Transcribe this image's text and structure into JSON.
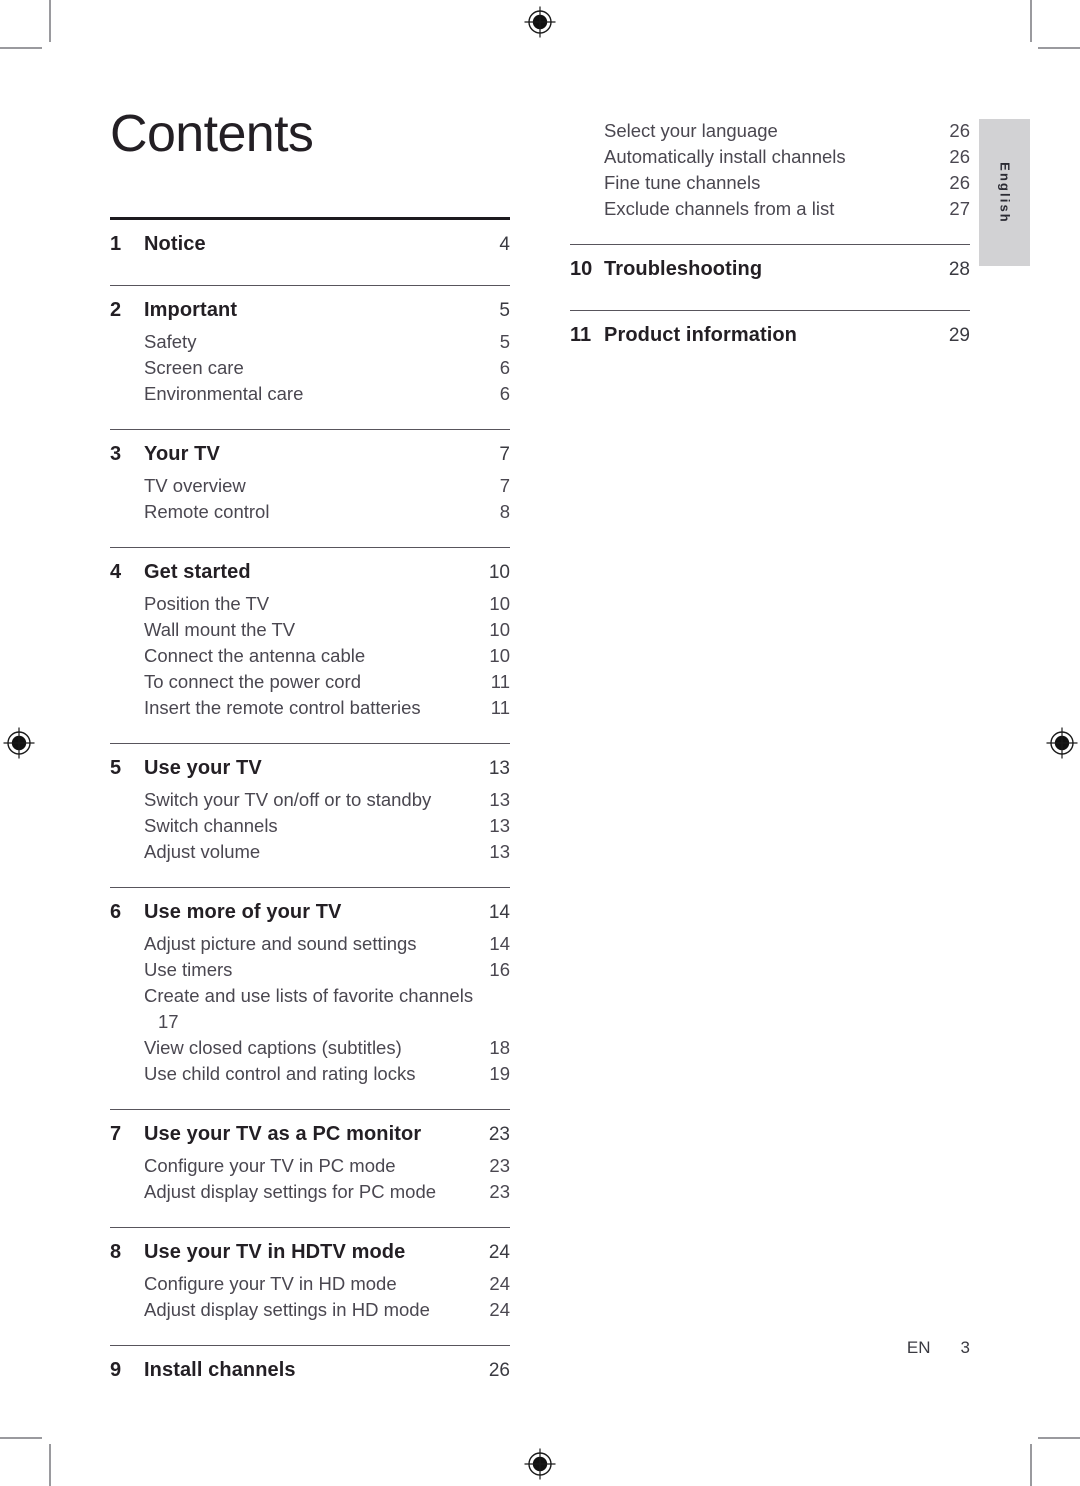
{
  "document": {
    "title": "Contents",
    "language_tab": "English",
    "footer": {
      "language_code": "EN",
      "page_number": "3"
    }
  },
  "left_column": {
    "groups": [
      {
        "rule": "thick",
        "entries": [
          {
            "type": "chapter",
            "num": "1",
            "label": "Notice",
            "page": "4"
          }
        ]
      },
      {
        "rule": "thin",
        "entries": [
          {
            "type": "chapter",
            "num": "2",
            "label": "Important",
            "page": "5"
          },
          {
            "type": "sub",
            "label": "Safety",
            "page": "5"
          },
          {
            "type": "sub",
            "label": "Screen care",
            "page": "6"
          },
          {
            "type": "sub",
            "label": "Environmental care",
            "page": "6"
          }
        ]
      },
      {
        "rule": "thin",
        "entries": [
          {
            "type": "chapter",
            "num": "3",
            "label": "Your TV",
            "page": "7"
          },
          {
            "type": "sub",
            "label": "TV overview",
            "page": "7"
          },
          {
            "type": "sub",
            "label": "Remote control",
            "page": "8"
          }
        ]
      },
      {
        "rule": "thin",
        "entries": [
          {
            "type": "chapter",
            "num": "4",
            "label": "Get started",
            "page": "10"
          },
          {
            "type": "sub",
            "label": "Position the TV",
            "page": "10"
          },
          {
            "type": "sub",
            "label": "Wall mount the TV",
            "page": "10"
          },
          {
            "type": "sub",
            "label": "Connect the antenna cable",
            "page": "10"
          },
          {
            "type": "sub",
            "label": "To connect the power cord",
            "page": "11"
          },
          {
            "type": "sub",
            "label": "Insert the remote control batteries",
            "page": "11"
          }
        ]
      },
      {
        "rule": "thin",
        "entries": [
          {
            "type": "chapter",
            "num": "5",
            "label": "Use your TV",
            "page": "13"
          },
          {
            "type": "sub",
            "label": "Switch your TV on/off or to standby",
            "page": "13"
          },
          {
            "type": "sub",
            "label": "Switch channels",
            "page": "13"
          },
          {
            "type": "sub",
            "label": "Adjust volume",
            "page": "13"
          }
        ]
      },
      {
        "rule": "thin",
        "entries": [
          {
            "type": "chapter",
            "num": "6",
            "label": "Use more of your TV",
            "page": "14"
          },
          {
            "type": "sub",
            "label": "Adjust picture and sound settings",
            "page": "14"
          },
          {
            "type": "sub",
            "label": "Use timers",
            "page": "16"
          },
          {
            "type": "sub-wrapped",
            "label": "Create and use lists of favorite channels",
            "page": "17"
          },
          {
            "type": "sub",
            "label": "View closed captions (subtitles)",
            "page": "18"
          },
          {
            "type": "sub",
            "label": "Use child control and rating locks",
            "page": "19"
          }
        ]
      },
      {
        "rule": "thin",
        "entries": [
          {
            "type": "chapter",
            "num": "7",
            "label": "Use your TV as a PC monitor",
            "page": "23"
          },
          {
            "type": "sub",
            "label": "Configure your TV in PC mode",
            "page": "23"
          },
          {
            "type": "sub",
            "label": "Adjust display settings for PC mode",
            "page": "23"
          }
        ]
      },
      {
        "rule": "thin",
        "entries": [
          {
            "type": "chapter",
            "num": "8",
            "label": "Use your TV in HDTV mode",
            "page": "24"
          },
          {
            "type": "sub",
            "label": "Configure your TV in HD mode",
            "page": "24"
          },
          {
            "type": "sub",
            "label": "Adjust display settings in HD mode",
            "page": "24"
          }
        ]
      },
      {
        "rule": "thin",
        "entries": [
          {
            "type": "chapter",
            "num": "9",
            "label": "Install channels",
            "page": "26"
          }
        ]
      }
    ]
  },
  "right_column": {
    "groups": [
      {
        "rule": "none",
        "entries": [
          {
            "type": "sub",
            "label": "Select your language",
            "page": "26"
          },
          {
            "type": "sub",
            "label": "Automatically install channels",
            "page": "26"
          },
          {
            "type": "sub",
            "label": "Fine tune channels",
            "page": "26"
          },
          {
            "type": "sub",
            "label": "Exclude channels from a list",
            "page": "27"
          }
        ]
      },
      {
        "rule": "thin",
        "entries": [
          {
            "type": "chapter",
            "num": "10",
            "label": "Troubleshooting",
            "page": "28"
          }
        ]
      },
      {
        "rule": "thin",
        "entries": [
          {
            "type": "chapter",
            "num": "11",
            "label": "Product information",
            "page": "29"
          }
        ]
      }
    ]
  }
}
